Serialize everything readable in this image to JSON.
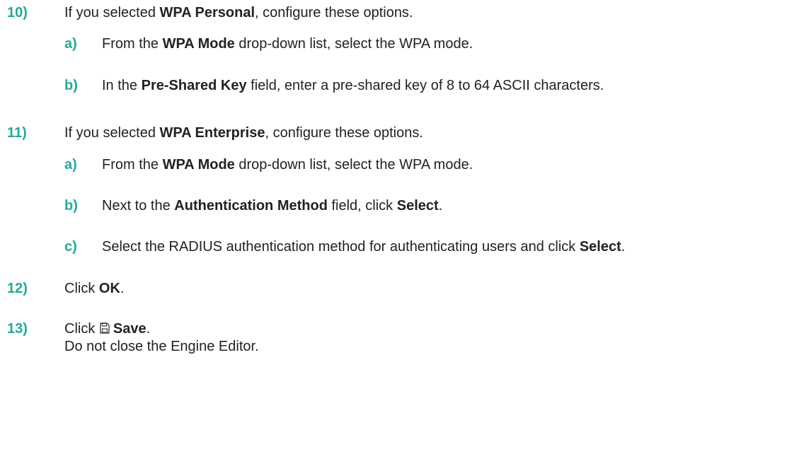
{
  "accent_color": "#22aa99",
  "steps": [
    {
      "num": "10)",
      "parts": [
        "If you selected ",
        "WPA Personal",
        ", configure these options."
      ],
      "substeps": [
        {
          "num": "a)",
          "parts": [
            "From the ",
            "WPA Mode",
            " drop-down list, select the WPA mode."
          ]
        },
        {
          "num": "b)",
          "parts": [
            "In the ",
            "Pre-Shared Key",
            " field, enter a pre-shared key of 8 to 64 ASCII characters."
          ]
        }
      ]
    },
    {
      "num": "11)",
      "parts": [
        "If you selected ",
        "WPA Enterprise",
        ", configure these options."
      ],
      "substeps": [
        {
          "num": "a)",
          "parts": [
            "From the ",
            "WPA Mode",
            " drop-down list, select the WPA mode."
          ]
        },
        {
          "num": "b)",
          "parts": [
            "Next to the ",
            "Authentication Method",
            " field, click ",
            "Select",
            "."
          ]
        },
        {
          "num": "c)",
          "parts": [
            "Select the RADIUS authentication method for authenticating users and click ",
            "Select",
            "."
          ]
        }
      ]
    },
    {
      "num": "12)",
      "parts": [
        "Click ",
        "OK",
        "."
      ]
    },
    {
      "num": "13)",
      "parts": [
        "Click ",
        "Save",
        "."
      ],
      "icon": "save-icon",
      "note": "Do not close the Engine Editor."
    }
  ]
}
